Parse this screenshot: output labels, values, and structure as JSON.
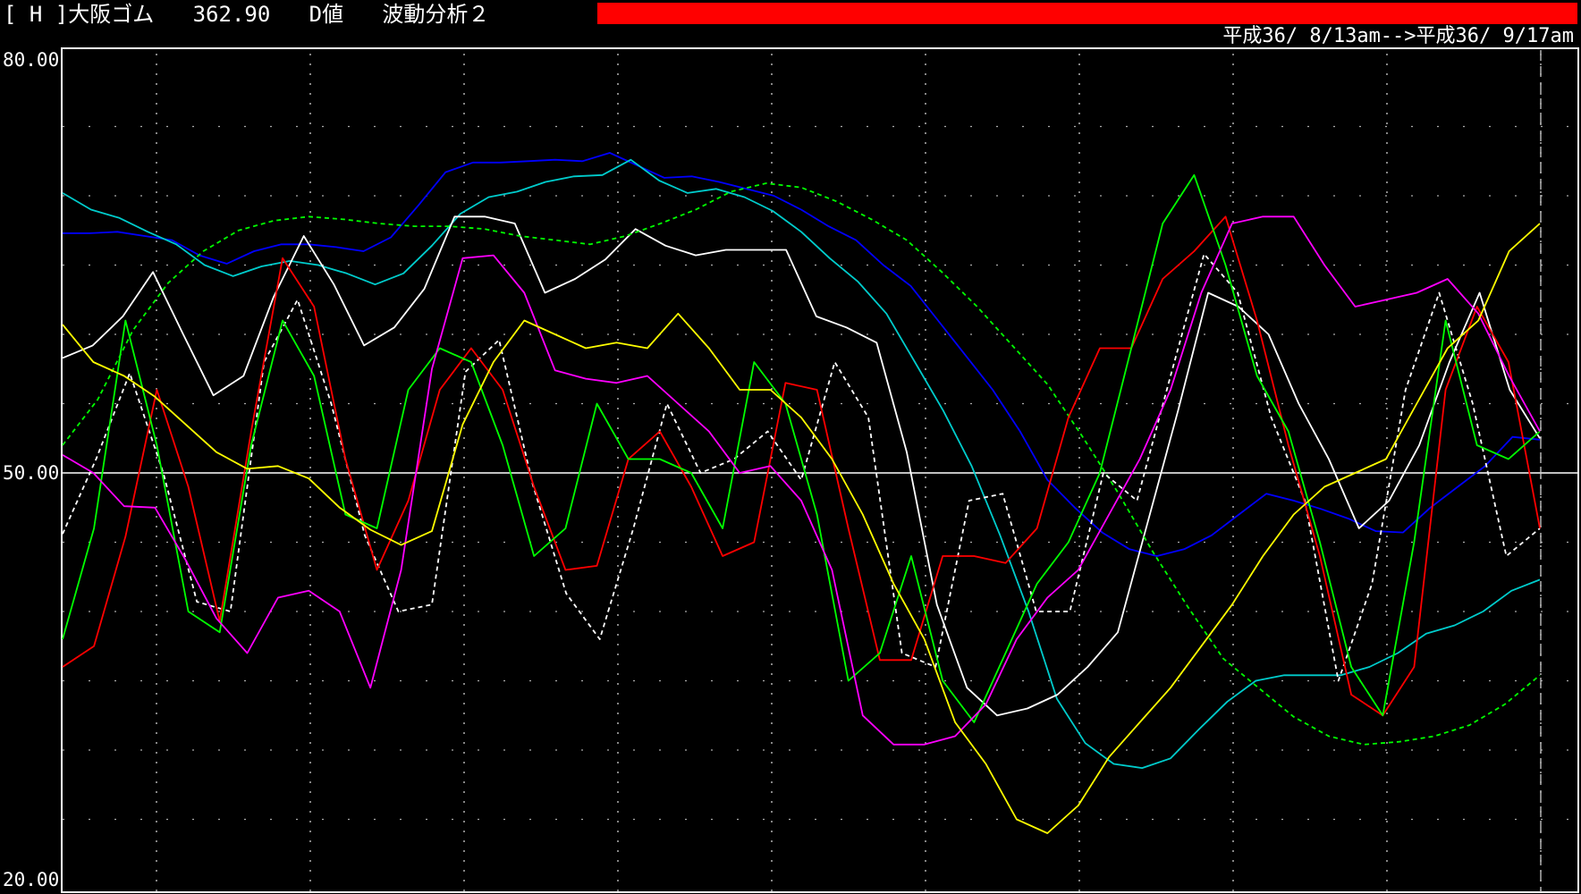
{
  "header": {
    "title": "[ H ]大阪ゴム   362.90   D値   波動分析２",
    "bar_color": "#ff0000",
    "date_range": "平成36/ 8/13am-->平成36/ 9/17am"
  },
  "chart_data": {
    "type": "line",
    "ylim": [
      20,
      80
    ],
    "yticks": [
      "80.00",
      "50.00",
      "20.00"
    ],
    "reference_line": 50,
    "grid": true,
    "x_count": 48,
    "series": [
      {
        "color": "#0000ff",
        "dashed": false,
        "values": [
          67.3,
          67.3,
          67.4,
          67.1,
          66.8,
          65.7,
          65.1,
          66.0,
          66.5,
          66.5,
          66.3,
          66.0,
          67.0,
          69.3,
          71.7,
          72.4,
          72.4,
          72.5,
          72.6,
          72.5,
          73.1,
          72.2,
          71.3,
          71.4,
          71.0,
          70.5,
          70.0,
          69.0,
          67.8,
          66.8,
          65.0,
          63.5,
          61.0,
          58.5,
          56.0,
          53.0,
          49.5,
          47.5,
          45.7,
          44.5,
          44.0,
          44.5,
          45.5,
          47.0,
          48.5,
          48.0,
          47.4,
          46.7,
          45.8,
          45.7,
          47.5,
          49.0,
          50.5,
          52.6,
          52.4
        ]
      },
      {
        "color": "#00cccc",
        "dashed": false,
        "values": [
          70.2,
          69.0,
          68.4,
          67.4,
          66.5,
          65.0,
          64.2,
          64.9,
          65.3,
          65.0,
          64.4,
          63.6,
          64.4,
          66.4,
          68.7,
          69.9,
          70.3,
          71.0,
          71.4,
          71.5,
          72.6,
          71.1,
          70.2,
          70.5,
          69.9,
          68.9,
          67.4,
          65.5,
          63.8,
          61.5,
          58.0,
          54.5,
          50.5,
          45.5,
          40.0,
          33.7,
          30.5,
          29.0,
          28.7,
          29.4,
          31.5,
          33.5,
          35.0,
          35.4,
          35.4,
          35.4,
          36.0,
          37.0,
          38.4,
          39.0,
          40.0,
          41.5,
          42.3
        ]
      },
      {
        "color": "#ffffff",
        "dashed": false,
        "values": [
          58.3,
          59.2,
          61.3,
          64.5,
          60.0,
          55.6,
          57.0,
          62.7,
          67.1,
          63.6,
          59.2,
          60.5,
          63.3,
          68.5,
          68.5,
          68.0,
          63.0,
          64.0,
          65.4,
          67.6,
          66.4,
          65.7,
          66.1,
          66.1,
          66.1,
          61.3,
          60.5,
          59.4,
          51.5,
          40.5,
          34.5,
          32.5,
          33.0,
          34.0,
          36.0,
          38.5,
          46.5,
          54.5,
          63.0,
          62.0,
          60.0,
          55.0,
          51.0,
          46.0,
          48.0,
          52.0,
          58.0,
          63.0,
          56.0,
          52.5
        ]
      },
      {
        "color": "#00ff00",
        "dashed": true,
        "values": [
          52.0,
          55.3,
          60.3,
          63.7,
          66.0,
          67.5,
          68.2,
          68.5,
          68.3,
          68.0,
          67.8,
          67.8,
          67.6,
          67.1,
          66.8,
          66.5,
          67.1,
          68.0,
          69.0,
          70.3,
          70.9,
          70.6,
          69.6,
          68.3,
          66.8,
          64.5,
          62.0,
          59.2,
          56.4,
          52.6,
          48.6,
          44.3,
          40.3,
          36.6,
          34.5,
          32.4,
          31.0,
          30.4,
          30.6,
          31.0,
          31.8,
          33.3,
          35.4
        ]
      },
      {
        "color": "#ffffff",
        "dashed": true,
        "values": [
          45.6,
          51.0,
          57.2,
          50.0,
          40.7,
          40.0,
          58.0,
          62.5,
          55.0,
          45.5,
          40.0,
          40.5,
          57.3,
          59.6,
          49.2,
          41.3,
          38.0,
          46.0,
          55.0,
          50.0,
          51.0,
          53.0,
          49.5,
          58.0,
          54.0,
          37.0,
          36.0,
          48.0,
          48.5,
          40.0,
          40.0,
          50.0,
          48.0,
          57.0,
          65.8,
          63.0,
          54.0,
          48.0,
          35.0,
          42.0,
          56.0,
          63.0,
          55.0,
          44.0,
          46.0
        ]
      },
      {
        "color": "#ff0000",
        "dashed": false,
        "values": [
          36.0,
          37.5,
          45.4,
          56.0,
          49.0,
          39.3,
          53.0,
          65.5,
          62.0,
          51.0,
          43.0,
          48.0,
          56.0,
          59.0,
          56.0,
          49.0,
          43.0,
          43.3,
          51.0,
          53.0,
          49.0,
          44.0,
          45.0,
          56.5,
          56.0,
          46.0,
          36.5,
          36.5,
          44.0,
          44.0,
          43.5,
          46.0,
          54.0,
          59.0,
          59.0,
          64.0,
          66.0,
          68.5,
          61.0,
          52.0,
          44.0,
          34.0,
          32.5,
          36.0,
          56.0,
          62.0,
          58.0,
          46.0
        ]
      },
      {
        "color": "#00ff00",
        "dashed": false,
        "values": [
          38.0,
          46.0,
          61.0,
          52.0,
          40.0,
          38.5,
          52.0,
          61.0,
          57.0,
          47.0,
          46.0,
          56.0,
          59.0,
          58.0,
          52.0,
          44.0,
          46.0,
          55.0,
          51.0,
          51.0,
          50.0,
          46.0,
          58.0,
          55.0,
          47.0,
          35.0,
          37.0,
          44.0,
          35.0,
          32.0,
          37.0,
          42.0,
          45.0,
          50.0,
          59.0,
          68.0,
          71.5,
          65.0,
          57.0,
          53.0,
          45.0,
          36.0,
          32.5,
          45.0,
          61.0,
          52.0,
          51.0,
          53.0
        ]
      },
      {
        "color": "#ff00ff",
        "dashed": false,
        "values": [
          51.3,
          50.0,
          47.6,
          47.5,
          43.7,
          39.5,
          37.0,
          41.0,
          41.5,
          40.0,
          34.5,
          43.0,
          57.5,
          65.5,
          65.7,
          63.0,
          57.4,
          56.8,
          56.5,
          57.0,
          55.0,
          53.0,
          50.0,
          50.5,
          48.0,
          43.0,
          32.5,
          30.4,
          30.4,
          31.0,
          33.3,
          38.0,
          41.0,
          43.0,
          47.0,
          51.0,
          56.0,
          63.0,
          68.0,
          68.5,
          68.5,
          65.0,
          62.0,
          62.5,
          63.0,
          64.0,
          61.5,
          57.0,
          53.0
        ]
      },
      {
        "color": "#ffff00",
        "dashed": false,
        "values": [
          60.7,
          58.0,
          57.0,
          55.5,
          53.5,
          51.5,
          50.3,
          50.5,
          49.6,
          47.5,
          45.9,
          44.8,
          45.8,
          53.5,
          58.0,
          61.0,
          60.0,
          59.0,
          59.4,
          59.0,
          61.5,
          59.0,
          56.0,
          56.0,
          54.0,
          51.0,
          47.0,
          42.0,
          38.0,
          32.0,
          29.0,
          25.0,
          24.0,
          26.0,
          29.5,
          32.0,
          34.5,
          37.5,
          40.5,
          44.0,
          47.0,
          49.0,
          50.0,
          51.0,
          55.0,
          59.0,
          61.0,
          66.0,
          68.0
        ]
      }
    ]
  }
}
